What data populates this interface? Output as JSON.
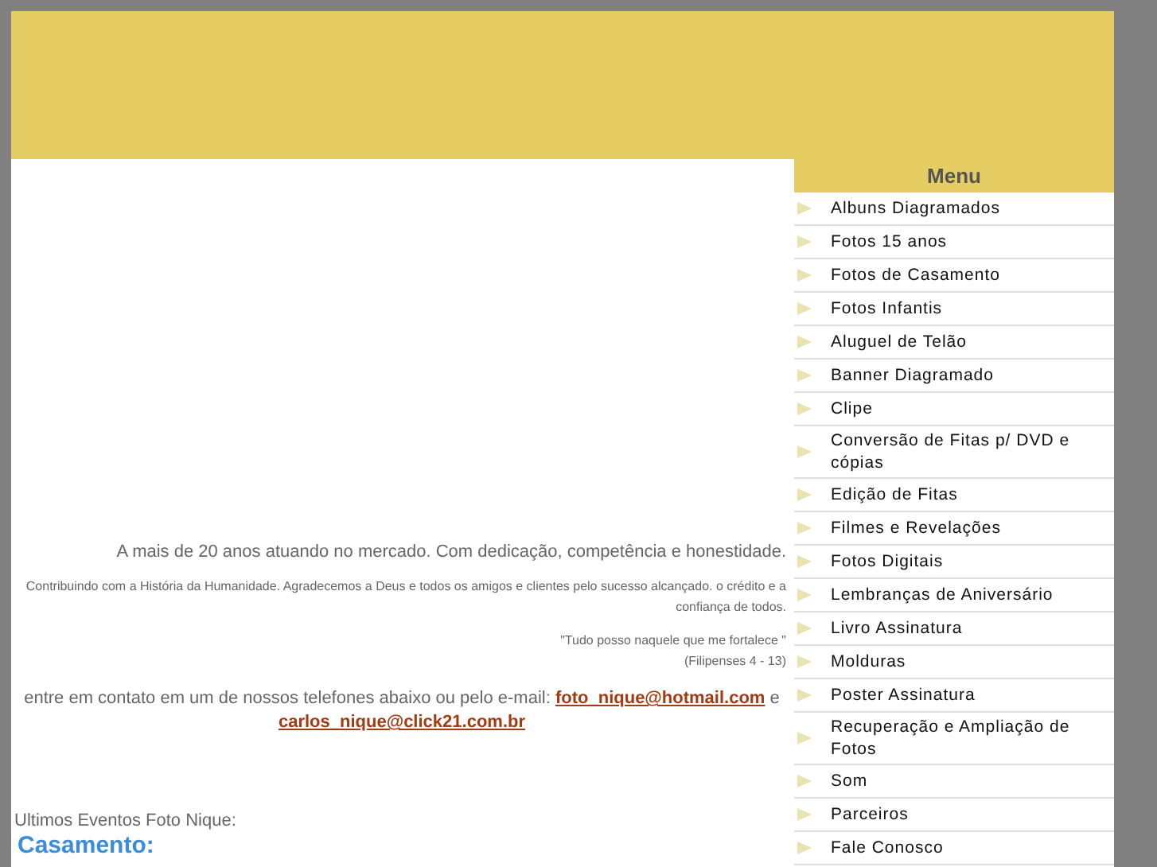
{
  "menu": {
    "title": "Menu",
    "items": [
      {
        "label": "Albuns Diagramados"
      },
      {
        "label": "Fotos 15 anos"
      },
      {
        "label": "Fotos de Casamento"
      },
      {
        "label": "Fotos Infantis"
      },
      {
        "label": "Aluguel de Telão"
      },
      {
        "label": "Banner Diagramado"
      },
      {
        "label": "Clipe"
      },
      {
        "label": "Conversão de Fitas p/ DVD e cópias"
      },
      {
        "label": "Edição de Fitas"
      },
      {
        "label": "Filmes e Revelações"
      },
      {
        "label": "Fotos Digitais"
      },
      {
        "label": "Lembranças de Aniversário"
      },
      {
        "label": "Livro Assinatura"
      },
      {
        "label": "Molduras"
      },
      {
        "label": "Poster Assinatura"
      },
      {
        "label": "Recuperação e Ampliação de Fotos"
      },
      {
        "label": "Som"
      },
      {
        "label": "Parceiros"
      },
      {
        "label": "Fale Conosco"
      }
    ]
  },
  "content": {
    "tagline": "A mais de 20 anos atuando no mercado. Com dedicação, competência e honestidade.",
    "thanks": "Contribuindo com a História da Humanidade. Agradecemos a Deus e todos os amigos e clientes pelo sucesso alcançado. o crédito e a confiança de todos.",
    "quote": "\"Tudo posso naquele que me fortalece \"",
    "quote_source": "(Filipenses 4 - 13)",
    "contact_text": "entre em contato em um de nossos telefones abaixo ou pelo e-mail:",
    "email_1": "foto_nique@hotmail.com",
    "conjunction": "e",
    "email_2": "carlos_nique@click21.com.br",
    "events_label": "Ultimos Eventos Foto Nique:",
    "events_heading": "Casamento:"
  }
}
